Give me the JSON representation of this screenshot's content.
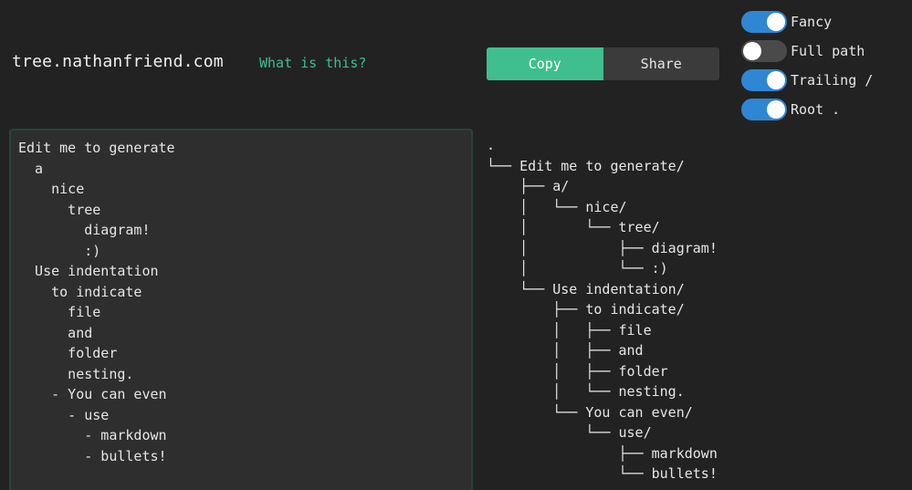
{
  "header": {
    "site_title": "tree.nathanfriend.com",
    "about_link": "What is this?"
  },
  "actions": {
    "copy_label": "Copy",
    "share_label": "Share"
  },
  "options": [
    {
      "label": "Fancy",
      "on": true
    },
    {
      "label": "Full path",
      "on": false
    },
    {
      "label": "Trailing /",
      "on": true
    },
    {
      "label": "Root .",
      "on": true
    }
  ],
  "editor": {
    "text": "Edit me to generate\n  a\n    nice\n      tree\n        diagram!\n        :)\n  Use indentation\n    to indicate\n      file\n      and\n      folder\n      nesting.\n    - You can even\n      - use\n        - markdown\n        - bullets!"
  },
  "output": {
    "tree": ".\n└── Edit me to generate/\n    ├── a/\n    │   └── nice/\n    │       └── tree/\n    │           ├── diagram!\n    │           └── :)\n    └── Use indentation/\n        ├── to indicate/\n        │   ├── file\n        │   ├── and\n        │   ├── folder\n        │   └── nesting.\n        └── You can even/\n            └── use/\n                ├── markdown\n                └── bullets!"
  },
  "colors": {
    "accent": "#3fbf8f",
    "toggle_on": "#2f86d4",
    "toggle_off": "#4a4a4a",
    "background": "#222222"
  }
}
